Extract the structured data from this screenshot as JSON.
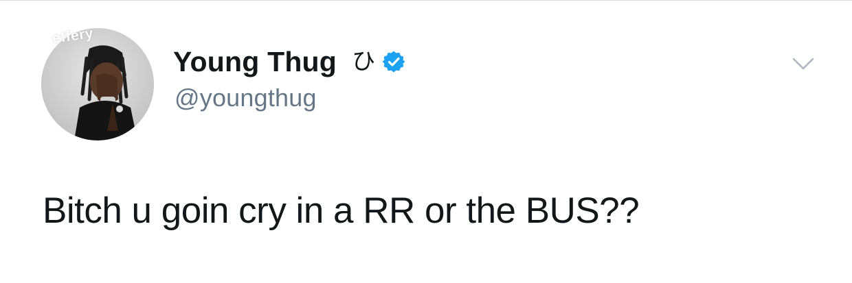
{
  "tweet": {
    "author": {
      "display_name": "Young Thug",
      "emoji": "ひ",
      "handle": "@youngthug",
      "verified": true,
      "avatar_watermark": "effery"
    },
    "text": "Bitch u goin cry in a RR or the BUS??",
    "icons": {
      "verified": "verified-badge-icon",
      "more": "chevron-down-icon"
    }
  },
  "colors": {
    "name": "#14171a",
    "handle": "#657786",
    "verified": "#1da1f2",
    "chevron": "#aab8c2"
  }
}
